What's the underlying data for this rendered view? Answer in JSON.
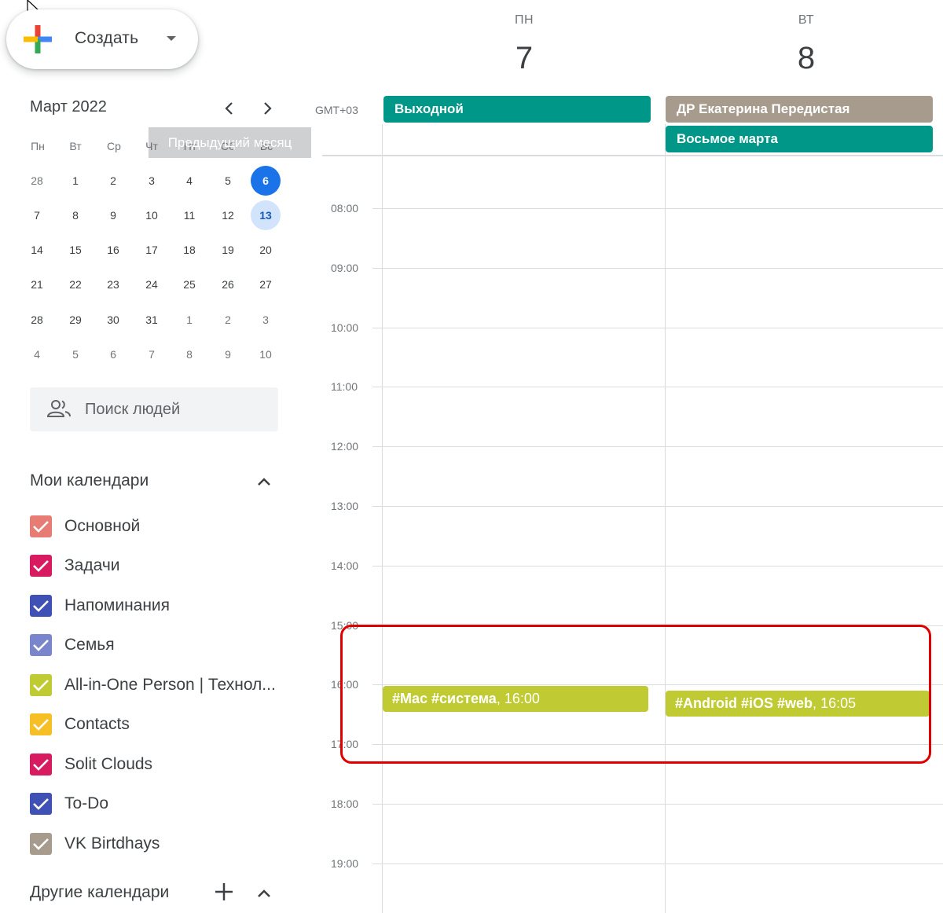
{
  "create": {
    "label": "Создать"
  },
  "mini_calendar": {
    "title": "Март 2022",
    "tooltip": "Предыдущий месяц",
    "weekdays": [
      "Пн",
      "Вт",
      "Ср",
      "Чт",
      "Пт",
      "Сб",
      "Вс"
    ],
    "weeks": [
      [
        "28",
        "1",
        "2",
        "3",
        "4",
        "5",
        "6"
      ],
      [
        "7",
        "8",
        "9",
        "10",
        "11",
        "12",
        "13"
      ],
      [
        "14",
        "15",
        "16",
        "17",
        "18",
        "19",
        "20"
      ],
      [
        "21",
        "22",
        "23",
        "24",
        "25",
        "26",
        "27"
      ],
      [
        "28",
        "29",
        "30",
        "31",
        "1",
        "2",
        "3"
      ],
      [
        "4",
        "5",
        "6",
        "7",
        "8",
        "9",
        "10"
      ]
    ]
  },
  "search_people": {
    "placeholder": "Поиск людей"
  },
  "my_calendars": {
    "title": "Мои календари",
    "items": [
      {
        "label": "Основной",
        "color": "#e67c73"
      },
      {
        "label": "Задачи",
        "color": "#d81b60"
      },
      {
        "label": "Напоминания",
        "color": "#3f51b5"
      },
      {
        "label": "Семья",
        "color": "#7986cb"
      },
      {
        "label": "All-in-One Person | Технол...",
        "color": "#c0ca33"
      },
      {
        "label": "Contacts",
        "color": "#f6bf26"
      },
      {
        "label": "Solit Clouds",
        "color": "#d81b60"
      },
      {
        "label": "To-Do",
        "color": "#3f51b5"
      },
      {
        "label": "VK Birtdhays",
        "color": "#a79b8e"
      }
    ]
  },
  "other_calendars": {
    "title": "Другие календари"
  },
  "timezone": "GMT+03",
  "days": [
    {
      "dow": "ПН",
      "num": "7"
    },
    {
      "dow": "ВТ",
      "num": "8"
    }
  ],
  "all_day": [
    {
      "title": "Выходной",
      "color": "#009688"
    },
    {
      "title": "ДР Екатерина Передистая",
      "color": "#a79b8e"
    },
    {
      "title": "Восьмое марта",
      "color": "#009688"
    }
  ],
  "hours": [
    "08:00",
    "09:00",
    "10:00",
    "11:00",
    "12:00",
    "13:00",
    "14:00",
    "15:00",
    "16:00",
    "17:00",
    "18:00",
    "19:00"
  ],
  "events": [
    {
      "title": "#Mac #система",
      "time": "16:00",
      "color": "#c0ca33"
    },
    {
      "title": "#Android #iOS #web",
      "time": "16:05",
      "color": "#c0ca33"
    }
  ]
}
